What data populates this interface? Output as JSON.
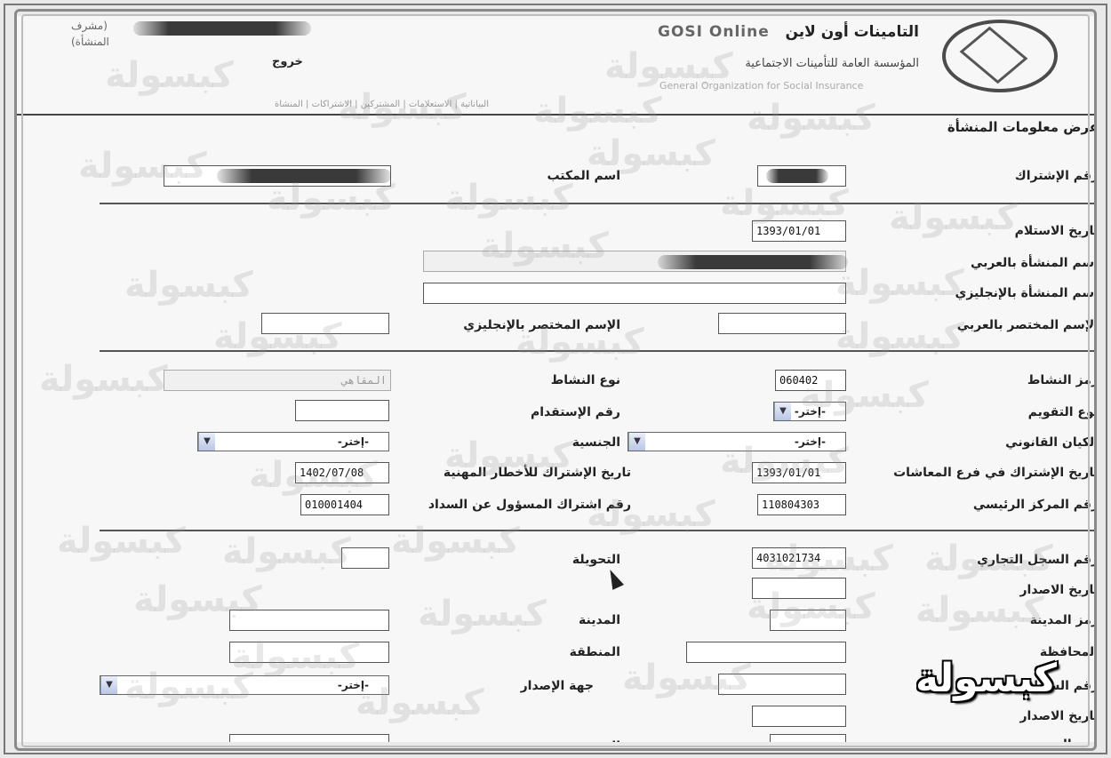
{
  "header": {
    "app_name_ar": "التامينات أون لاين",
    "app_name_en": "GOSI Online",
    "org_name_ar": "المؤسسة العامة للتأمينات الاجتماعية",
    "org_name_en": "General Organization for Social Insurance",
    "user_line": "(مشرف",
    "user_line2": "المنشأة)",
    "logout": "خروج",
    "nav_links": "البياناتية | الاستعلامات | المشتركين | الاشتراكات | المنشأة"
  },
  "section_title": "عرض معلومات المنشأة",
  "fields": {
    "subscription_no": {
      "label": "رقم الإشتراك",
      "value": ""
    },
    "office_name": {
      "label": "اسم المكتب",
      "value": ""
    },
    "receipt_date": {
      "label": "تاريخ الاستلام",
      "value": "1393/01/01"
    },
    "name_ar": {
      "label": "اسم المنشأة بالعربي",
      "value": ""
    },
    "name_en": {
      "label": "اسم المنشأة بالإنجليزي",
      "value": ""
    },
    "short_ar": {
      "label": "الإسم المختصر بالعربي",
      "value": ""
    },
    "short_en": {
      "label": "الإسم المختصر بالإنجليزي",
      "value": ""
    },
    "activity_code": {
      "label": "رمز النشاط",
      "value": "060402"
    },
    "activity_type": {
      "label": "نوع النشاط",
      "value": "المقاهي"
    },
    "calendar_type": {
      "label": "نوع التقويم",
      "value": "-إختر-"
    },
    "employer_no": {
      "label": "رقم الإستقدام",
      "value": ""
    },
    "legal_entity": {
      "label": "الكيان القانوني",
      "value": "-إختر-"
    },
    "nationality": {
      "label": "الجنسية",
      "value": "-إختر-"
    },
    "pension_sub_date": {
      "label": "تاريخ الإشتراك في فرع المعاشات",
      "value": "1393/01/01"
    },
    "hazards_sub_date": {
      "label": "تاريخ الإشتراك للأخطار المهنية",
      "value": "1402/07/08"
    },
    "main_center": {
      "label": "رقم المركز الرئيسي",
      "value": "110804303"
    },
    "payer_sub_no": {
      "label": "رقم اشتراك المسؤول عن السداد",
      "value": "010001404"
    },
    "cr_no": {
      "label": "رقم السجل التجاري",
      "value": "4031021734"
    },
    "transfer": {
      "label": "التحويلة",
      "value": ""
    },
    "issue_date": {
      "label": "تاريخ الاصدار",
      "value": ""
    },
    "city_code": {
      "label": "رمز المدينة",
      "value": ""
    },
    "city": {
      "label": "المدينة",
      "value": ""
    },
    "governorate": {
      "label": "المحافظة",
      "value": ""
    },
    "region": {
      "label": "المنطقة",
      "value": ""
    },
    "cr_no2": {
      "label": "رقم السجل",
      "value": ""
    },
    "issuer": {
      "label": "جهة الإصدار",
      "value": "-إختر-"
    },
    "issue_date2": {
      "label": "تاريخ الاصدار",
      "value": ""
    },
    "city_code2": {
      "label": "رمز المدينة",
      "value": ""
    },
    "city2": {
      "label": "المدينة",
      "value": ""
    }
  },
  "watermark": "كبسولة",
  "brand": "كبسولة"
}
